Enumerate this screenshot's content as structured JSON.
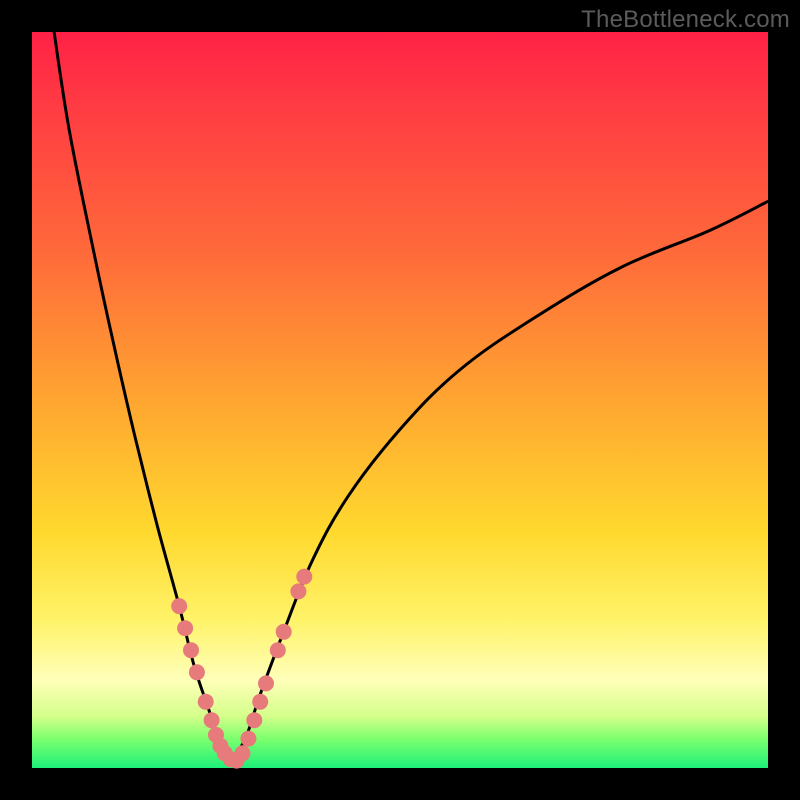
{
  "watermark": "TheBottleneck.com",
  "colors": {
    "frame": "#000000",
    "gradient_top": "#ff2146",
    "gradient_mid": "#ffd92e",
    "gradient_bottom": "#1ef07a",
    "curve": "#000000",
    "marker": "#e77b7b"
  },
  "chart_data": {
    "type": "line",
    "title": "",
    "xlabel": "",
    "ylabel": "",
    "xlim": [
      0,
      100
    ],
    "ylim": [
      0,
      100
    ],
    "grid": false,
    "legend": false,
    "series": [
      {
        "name": "left-branch",
        "x": [
          3,
          5,
          8,
          11,
          14,
          17,
          20,
          22,
          24,
          25.5,
          27
        ],
        "y": [
          100,
          87,
          72,
          58,
          45,
          33,
          22,
          14,
          8,
          3.5,
          1
        ]
      },
      {
        "name": "right-branch",
        "x": [
          27,
          29,
          31,
          34,
          38,
          43,
          50,
          58,
          68,
          80,
          92,
          100
        ],
        "y": [
          1,
          4,
          10,
          18,
          28,
          37,
          46,
          54,
          61,
          68,
          73,
          77
        ]
      }
    ],
    "markers": [
      {
        "branch": "left",
        "x": 20.0,
        "y": 22.0
      },
      {
        "branch": "left",
        "x": 20.8,
        "y": 19.0
      },
      {
        "branch": "left",
        "x": 21.6,
        "y": 16.0
      },
      {
        "branch": "left",
        "x": 22.4,
        "y": 13.0
      },
      {
        "branch": "left",
        "x": 23.6,
        "y": 9.0
      },
      {
        "branch": "left",
        "x": 24.4,
        "y": 6.5
      },
      {
        "branch": "left",
        "x": 25.0,
        "y": 4.5
      },
      {
        "branch": "left",
        "x": 25.6,
        "y": 3.0
      },
      {
        "branch": "left",
        "x": 26.2,
        "y": 2.0
      },
      {
        "branch": "left",
        "x": 27.0,
        "y": 1.2
      },
      {
        "branch": "left",
        "x": 27.8,
        "y": 1.0
      },
      {
        "branch": "right",
        "x": 28.6,
        "y": 2.0
      },
      {
        "branch": "right",
        "x": 29.4,
        "y": 4.0
      },
      {
        "branch": "right",
        "x": 30.2,
        "y": 6.5
      },
      {
        "branch": "right",
        "x": 31.0,
        "y": 9.0
      },
      {
        "branch": "right",
        "x": 31.8,
        "y": 11.5
      },
      {
        "branch": "right",
        "x": 33.4,
        "y": 16.0
      },
      {
        "branch": "right",
        "x": 34.2,
        "y": 18.5
      },
      {
        "branch": "right",
        "x": 36.2,
        "y": 24.0
      },
      {
        "branch": "right",
        "x": 37.0,
        "y": 26.0
      }
    ],
    "note": "Axes are unlabeled in the source image; x and y values are read as percentages of the plotting area (0 at left/bottom, 100 at right/top)."
  }
}
